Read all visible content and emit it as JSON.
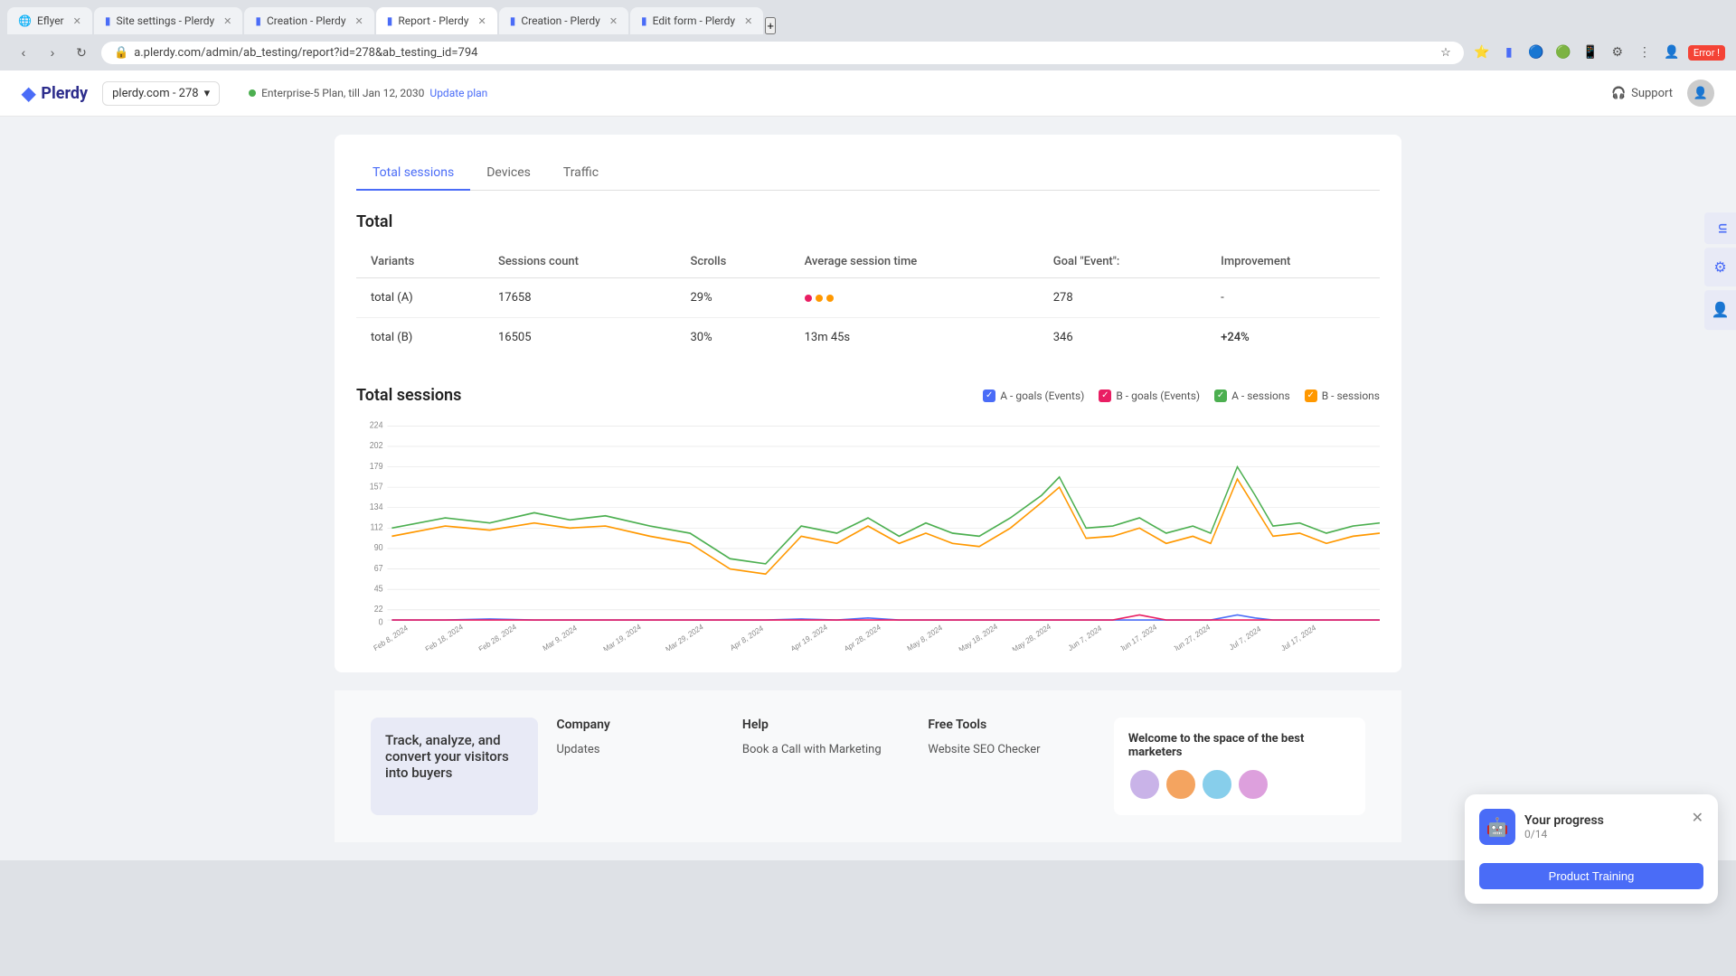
{
  "browser": {
    "tabs": [
      {
        "label": "Eflyer",
        "icon": "🌐",
        "active": false
      },
      {
        "label": "Site settings - Plerdy",
        "icon": "📊",
        "active": false
      },
      {
        "label": "Creation - Plerdy",
        "icon": "📊",
        "active": false
      },
      {
        "label": "Report - Plerdy",
        "icon": "📊",
        "active": true
      },
      {
        "label": "Creation - Plerdy",
        "icon": "📊",
        "active": false
      },
      {
        "label": "Edit form - Plerdy",
        "icon": "📊",
        "active": false
      }
    ],
    "url": "a.plerdy.com/admin/ab_testing/report?id=278&ab_testing_id=794",
    "error_badge": "Error !"
  },
  "header": {
    "logo_text": "Plerdy",
    "site_selector": "plerdy.com - 278",
    "plan_text": "Enterprise-5 Plan, till Jan 12, 2030",
    "update_link": "Update plan",
    "support_label": "Support"
  },
  "tabs": {
    "items": [
      "Total sessions",
      "Devices",
      "Traffic"
    ],
    "active": 0
  },
  "table": {
    "title": "Total",
    "columns": [
      "Variants",
      "Sessions count",
      "Scrolls",
      "Average session time",
      "Goal \"Event\":",
      "Improvement"
    ],
    "rows": [
      {
        "variant": "total (A)",
        "sessions": "17658",
        "scrolls": "29%",
        "avg_time": "dots",
        "goal": "278",
        "improvement": "-"
      },
      {
        "variant": "total (B)",
        "sessions": "16505",
        "scrolls": "30%",
        "avg_time": "13m 45s",
        "goal": "346",
        "improvement": "+24%"
      }
    ]
  },
  "chart": {
    "title": "Total sessions",
    "legend": [
      {
        "label": "A - goals (Events)",
        "color": "#4a6cf7",
        "type": "checkbox"
      },
      {
        "label": "B - goals (Events)",
        "color": "#e91e63",
        "type": "checkbox"
      },
      {
        "label": "A - sessions",
        "color": "#4caf50",
        "type": "checkbox"
      },
      {
        "label": "B - sessions",
        "color": "#ff9800",
        "type": "checkbox"
      }
    ],
    "y_labels": [
      "224",
      "202",
      "179",
      "157",
      "134",
      "112",
      "90",
      "67",
      "45",
      "22",
      "0"
    ],
    "x_labels": [
      "Feb 8, 2024",
      "Feb 18, 2024",
      "Feb 28, 2024",
      "Mar 9, 2024",
      "Mar 19, 2024",
      "Mar 29, 2024",
      "Apr 8, 2024",
      "Apr 19, 2024",
      "Apr 28, 2024",
      "May 8, 2024",
      "May 18, 2024",
      "May 28, 2024",
      "Jun 7, 2024",
      "Jun 17, 2024",
      "Jun 27, 2024",
      "Jul 7, 2024",
      "Jul 17, 2024"
    ]
  },
  "progress_widget": {
    "title": "Your progress",
    "count": "0/14",
    "button_label": "Product Training"
  },
  "footer": {
    "tagline": "Track, analyze, and convert your visitors into buyers",
    "company": {
      "title": "Company",
      "links": [
        "Updates"
      ]
    },
    "help": {
      "title": "Help",
      "links": [
        "Book a Call with Marketing"
      ]
    },
    "free_tools": {
      "title": "Free Tools",
      "links": [
        "Website SEO Checker"
      ]
    },
    "welcome": {
      "title": "Welcome to the space of the best marketers"
    }
  },
  "right_sidebar": {
    "items": [
      "UI",
      "⚙",
      "👤"
    ]
  }
}
